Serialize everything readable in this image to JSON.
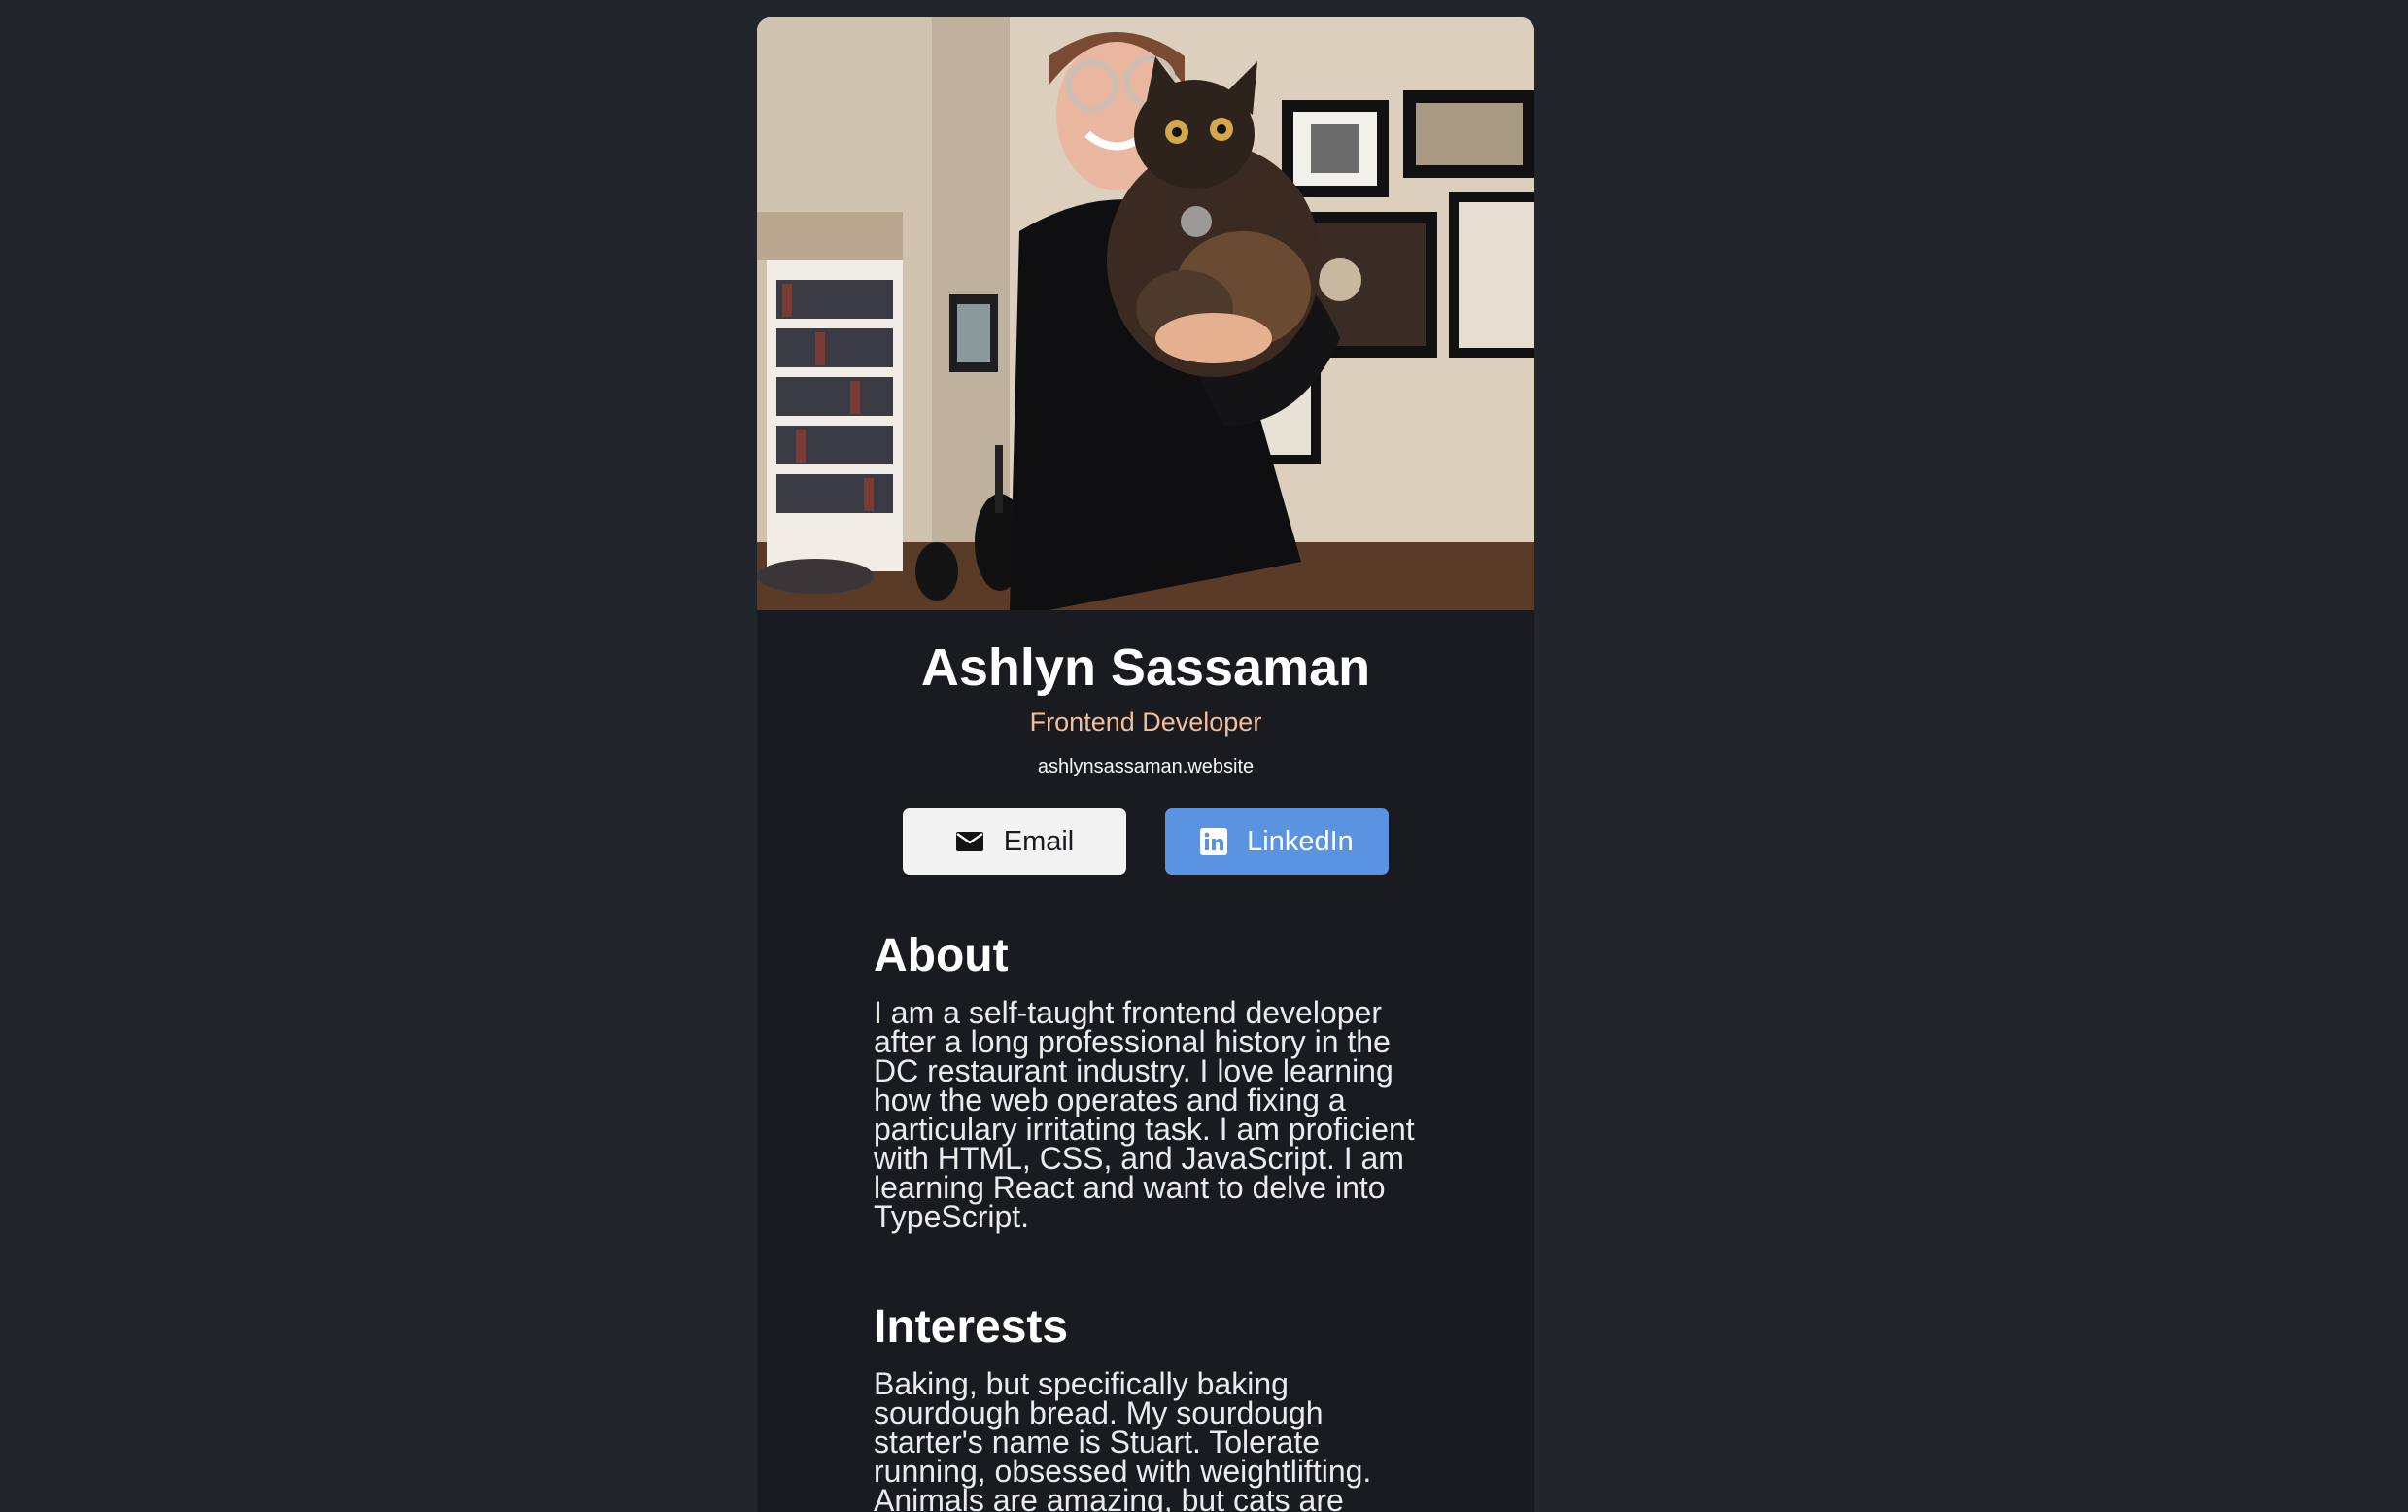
{
  "profile": {
    "name": "Ashlyn Sassaman",
    "role": "Frontend Developer",
    "website": "ashlynsassaman.website"
  },
  "buttons": {
    "email_label": "Email",
    "linkedin_label": "LinkedIn"
  },
  "icons": {
    "email": "envelope-icon",
    "linkedin": "linkedin-icon"
  },
  "about": {
    "heading": "About",
    "text": "I am a self-taught frontend developer after a long professional history in the DC restaurant industry. I love learning how the web operates and fixing a particulary irritating task. I am proficient with HTML, CSS, and JavaScript. I am learning React and want to delve into TypeScript."
  },
  "interests": {
    "heading": "Interests",
    "text": "Baking, but specifically baking sourdough bread. My sourdough starter's name is Stuart. Tolerate running, obsessed with weightlifting. Animals are amazing, but cats are"
  },
  "colors": {
    "page_bg": "#23252c",
    "card_bg": "#1a1b21",
    "accent_role": "#f3bf99",
    "linkedin_blue": "#5a93e1",
    "email_button": "#f3f3f3"
  }
}
